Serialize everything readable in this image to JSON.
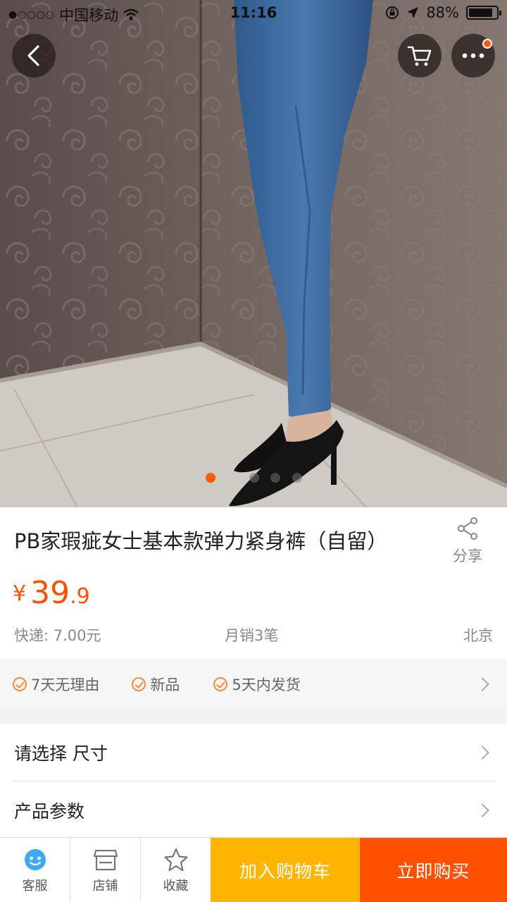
{
  "status_bar": {
    "carrier": "中国移动",
    "time": "11:16",
    "battery": "88%",
    "battery_level": 0.88
  },
  "header": {
    "back_icon": "chevron-left-icon",
    "cart_icon": "cart-icon",
    "more_icon": "more-icon",
    "has_notification": true
  },
  "gallery": {
    "image_description_icon": "product-photo",
    "page_count": 4,
    "active_index": 0
  },
  "product": {
    "title": "PB家瑕疵女士基本款弹力紧身裤（自留）",
    "currency": "¥",
    "price_int": "39",
    "price_dec": ".9",
    "shipping": "快递: 7.00元",
    "monthly_sales": "月销3笔",
    "location": "北京",
    "share_label": "分享"
  },
  "guarantees": [
    {
      "label": "7天无理由"
    },
    {
      "label": "新品"
    },
    {
      "label": "5天内发货"
    }
  ],
  "options": {
    "select_size": "请选择 尺寸",
    "params": "产品参数"
  },
  "bottom_bar": {
    "service": "客服",
    "shop": "店铺",
    "favorite": "收藏",
    "add_to_cart": "加入购物车",
    "buy_now": "立即购买"
  },
  "colors": {
    "accent": "#ff5000",
    "cart_button": "#ffb400",
    "notification": "#ff5a00"
  }
}
